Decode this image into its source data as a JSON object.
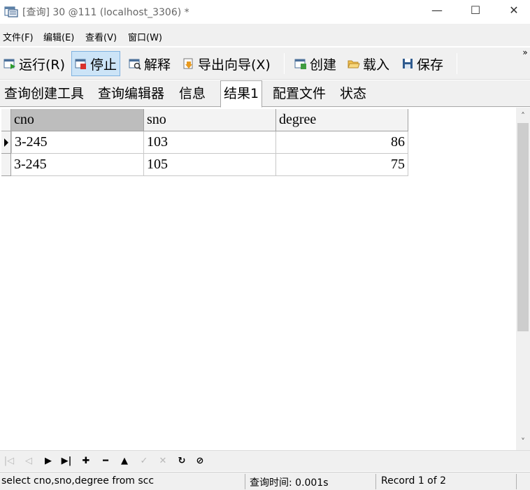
{
  "window": {
    "title": "[查询] 30 @111 (localhost_3306) *",
    "minimize": "—",
    "maximize": "☐",
    "close": "✕"
  },
  "menu": [
    "文件(F)",
    "编辑(E)",
    "查看(V)",
    "窗口(W)"
  ],
  "toolbar": {
    "run": "运行(R)",
    "stop": "停止",
    "explain": "解释",
    "export_wizard": "导出向导(X)",
    "create": "创建",
    "load": "载入",
    "save": "保存",
    "more": "»"
  },
  "tabs": [
    "查询创建工具",
    "查询编辑器",
    "信息",
    "结果1",
    "配置文件",
    "状态"
  ],
  "active_tab": "结果1",
  "grid": {
    "columns": [
      "cno",
      "sno",
      "degree"
    ],
    "rows": [
      [
        "3-245",
        "103",
        "86"
      ],
      [
        "3-245",
        "105",
        "75"
      ]
    ]
  },
  "scroll": {
    "up": "˄",
    "down": "˅"
  },
  "navigator": {
    "first": "|◁",
    "prev": "◁",
    "next": "▶",
    "last": "▶|",
    "insert": "✚",
    "delete": "━",
    "post": "▲",
    "commit": "✓",
    "cancel": "✕",
    "refresh": "↻",
    "stop": "⊘"
  },
  "status": {
    "sql": "select cno,sno,degree from scc",
    "query_time": "查询时间: 0.001s",
    "record": "Record 1 of 2"
  },
  "colors": {
    "selected_button": "#cce4f7",
    "sorted_header": "#bdbdbd",
    "chrome": "#f0f0f0"
  }
}
